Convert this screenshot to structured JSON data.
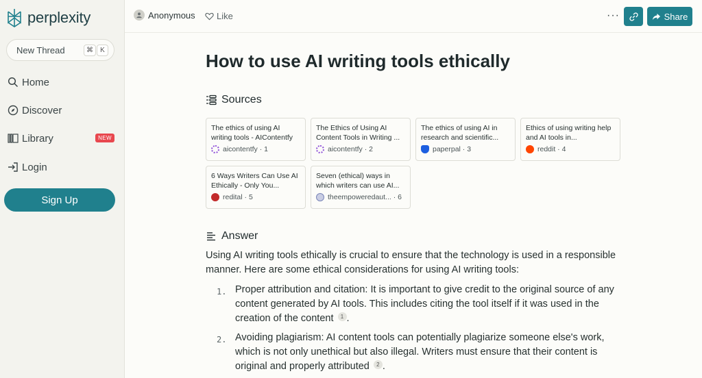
{
  "sidebar": {
    "logo_text": "perplexity",
    "new_thread": {
      "label": "New Thread",
      "kbd_cmd": "⌘",
      "kbd_key": "K"
    },
    "nav": [
      {
        "label": "Home",
        "icon": "search-icon"
      },
      {
        "label": "Discover",
        "icon": "compass-icon"
      },
      {
        "label": "Library",
        "icon": "library-icon",
        "badge": "NEW"
      },
      {
        "label": "Login",
        "icon": "login-icon"
      }
    ],
    "signup_label": "Sign Up"
  },
  "topbar": {
    "user": "Anonymous",
    "like": "Like",
    "more": "···",
    "share": "Share"
  },
  "thread": {
    "title": "How to use AI writing tools ethically",
    "sources_heading": "Sources",
    "sources": [
      {
        "title": "The ethics of using AI writing tools - AIContentfy",
        "site": "aicontentfy",
        "index": "1",
        "icon_color": "#8e4fd8"
      },
      {
        "title": "The Ethics of Using AI Content Tools in Writing ...",
        "site": "aicontentfy",
        "index": "2",
        "icon_color": "#8e4fd8"
      },
      {
        "title": "The ethics of using AI in research and scientific...",
        "site": "paperpal",
        "index": "3",
        "icon_color": "#1d5fe0"
      },
      {
        "title": "Ethics of using writing help and AI tools in...",
        "site": "reddit",
        "index": "4",
        "icon_color": "#ff4500"
      },
      {
        "title": "6 Ways Writers Can Use AI Ethically - Only You...",
        "site": "redital",
        "index": "5",
        "icon_color": "#c22b2b"
      },
      {
        "title": "Seven (ethical) ways in which writers can use AI...",
        "site": "theempoweredaut...",
        "index": "6",
        "icon_color": "#7a86b8"
      }
    ],
    "answer_heading": "Answer",
    "answer_intro": "Using AI writing tools ethically is crucial to ensure that the technology is used in a responsible manner. Here are some ethical considerations for using AI writing tools:",
    "answer_items": [
      {
        "num": "1.",
        "text": "Proper attribution and citation: It is important to give credit to the original source of any content generated by AI tools. This includes citing the tool itself if it was used in the creation of the content",
        "cite": "1",
        "tail": "."
      },
      {
        "num": "2.",
        "text": "Avoiding plagiarism: AI content tools can potentially plagiarize someone else's work, which is not only unethical but also illegal. Writers must ensure that their content is original and properly attributed",
        "cite": "2",
        "tail": "."
      }
    ]
  },
  "colors": {
    "accent": "#20808d",
    "badge": "#e8474e",
    "sidebar_bg": "#f3f3ee",
    "main_bg": "#fcfcf9"
  }
}
